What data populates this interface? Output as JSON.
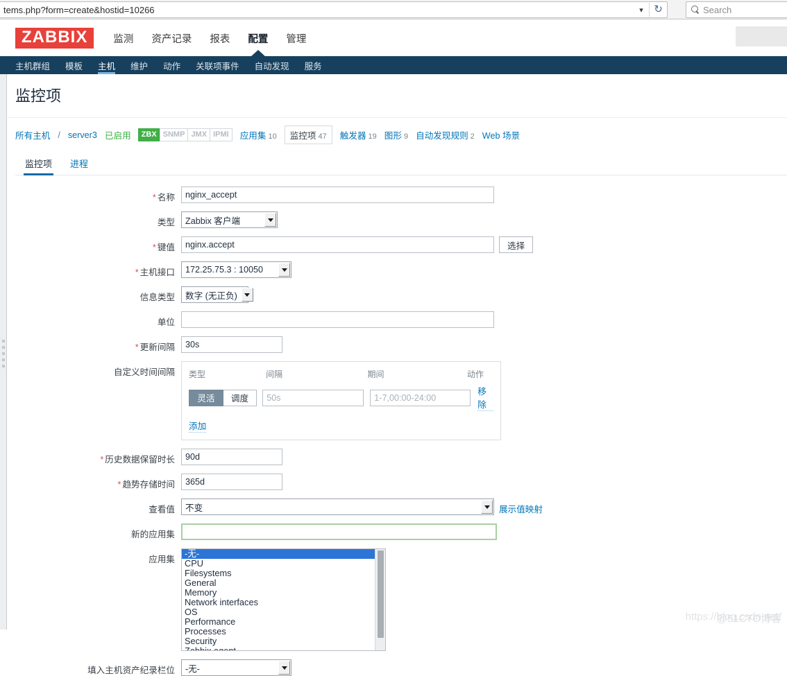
{
  "browser": {
    "url": "tems.php?form=create&hostid=10266",
    "chevron_icon": "chevron-down-icon",
    "reload_icon": "reload-icon",
    "search_icon": "search-icon",
    "search_placeholder": "Search"
  },
  "header": {
    "logo": "ZABBIX",
    "nav": [
      {
        "label": "监测",
        "active": false
      },
      {
        "label": "资产记录",
        "active": false
      },
      {
        "label": "报表",
        "active": false
      },
      {
        "label": "配置",
        "active": true
      },
      {
        "label": "管理",
        "active": false
      }
    ]
  },
  "subnav": [
    {
      "label": "主机群组",
      "active": false
    },
    {
      "label": "模板",
      "active": false
    },
    {
      "label": "主机",
      "active": true
    },
    {
      "label": "维护",
      "active": false
    },
    {
      "label": "动作",
      "active": false
    },
    {
      "label": "关联项事件",
      "active": false
    },
    {
      "label": "自动发现",
      "active": false
    },
    {
      "label": "服务",
      "active": false
    }
  ],
  "page": {
    "title": "监控项"
  },
  "breadcrumb": {
    "all_hosts": "所有主机",
    "separator": "/",
    "host": "server3",
    "enabled": "已启用",
    "badges": [
      {
        "label": "ZBX",
        "on": true
      },
      {
        "label": "SNMP",
        "on": false
      },
      {
        "label": "JMX",
        "on": false
      },
      {
        "label": "IPMI",
        "on": false
      }
    ],
    "links": [
      {
        "label": "应用集",
        "count": "10",
        "current": false
      },
      {
        "label": "监控项",
        "count": "47",
        "current": true
      },
      {
        "label": "触发器",
        "count": "19",
        "current": false
      },
      {
        "label": "图形",
        "count": "9",
        "current": false
      },
      {
        "label": "自动发现规则",
        "count": "2",
        "current": false
      },
      {
        "label": "Web 场景",
        "count": "",
        "current": false
      }
    ]
  },
  "tabs": [
    {
      "label": "监控项",
      "active": true
    },
    {
      "label": "进程",
      "active": false
    }
  ],
  "form": {
    "name": {
      "label": "名称",
      "required": true,
      "value": "nginx_accept"
    },
    "type": {
      "label": "类型",
      "required": false,
      "value": "Zabbix 客户端"
    },
    "key": {
      "label": "键值",
      "required": true,
      "value": "nginx.accept",
      "button": "选择"
    },
    "host_interface": {
      "label": "主机接口",
      "required": true,
      "value": "172.25.75.3 : 10050"
    },
    "info_type": {
      "label": "信息类型",
      "required": false,
      "value": "数字 (无正负)"
    },
    "units": {
      "label": "单位",
      "required": false,
      "value": ""
    },
    "update_interval": {
      "label": "更新间隔",
      "required": true,
      "value": "30s"
    },
    "custom_intervals": {
      "label": "自定义时间间隔",
      "columns": {
        "type": "类型",
        "interval": "间隔",
        "period": "期间",
        "action": "动作"
      },
      "rows": [
        {
          "type_flexible": "灵活",
          "type_scheduling": "调度",
          "selected": "灵活",
          "interval_placeholder": "50s",
          "interval_value": "",
          "period_placeholder": "1-7,00:00-24:00",
          "period_value": "",
          "remove": "移除"
        }
      ],
      "add": "添加"
    },
    "history": {
      "label": "历史数据保留时长",
      "required": true,
      "value": "90d"
    },
    "trends": {
      "label": "趋势存储时间",
      "required": true,
      "value": "365d"
    },
    "view_value": {
      "label": "查看值",
      "required": false,
      "value": "不变",
      "link": "展示值映射"
    },
    "new_application": {
      "label": "新的应用集",
      "required": false,
      "value": "",
      "focused": true
    },
    "applications": {
      "label": "应用集",
      "options": [
        "-无-",
        "CPU",
        "Filesystems",
        "General",
        "Memory",
        "Network interfaces",
        "OS",
        "Performance",
        "Processes",
        "Security",
        "Zabbix agent"
      ],
      "selected": "-无-"
    },
    "inventory_field": {
      "label": "填入主机资产纪录栏位",
      "required": false,
      "value": "-无-"
    }
  },
  "watermark": {
    "primary": "https://blog.csdn.net/",
    "secondary": "@51CTO博客"
  }
}
